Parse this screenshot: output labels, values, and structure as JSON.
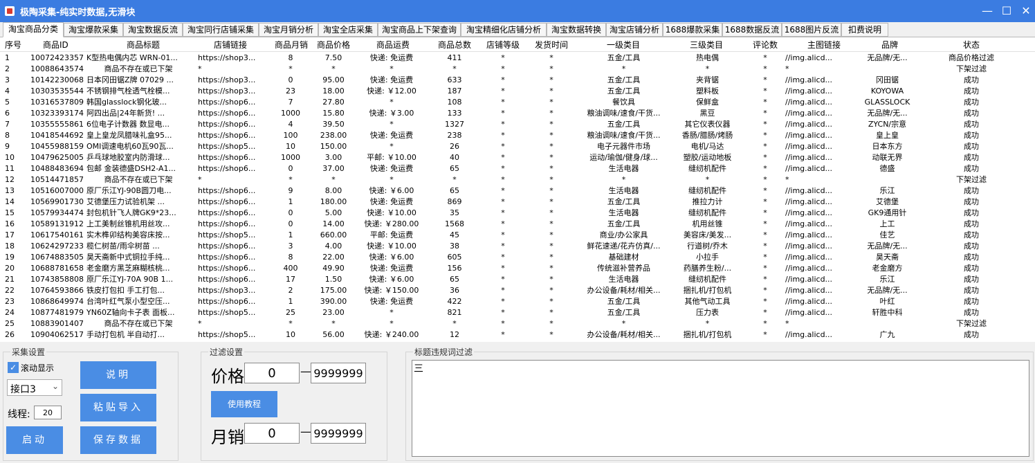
{
  "title": "极陶采集-纯实时数据,无滑块",
  "tabs": [
    "淘宝商品分类",
    "淘宝爆款采集",
    "淘宝数据反流",
    "淘宝同行店铺采集",
    "淘宝月销分析",
    "淘宝全店采集",
    "淘宝商品上下架查询",
    "淘宝精细化店铺分析",
    "淘宝数据转换",
    "淘宝店铺分析",
    "1688爆款采集",
    "1688数据反流",
    "1688图片反流",
    "扣费说明"
  ],
  "columns": [
    "序号",
    "商品ID",
    "商品标题",
    "店铺链接",
    "商品月销",
    "商品价格",
    "商品运费",
    "商品总数",
    "店铺等级",
    "发货时间",
    "一级类目",
    "三级类目",
    "评论数",
    "主图链接",
    "品牌",
    "状态"
  ],
  "rows": [
    [
      "1",
      "10072423357",
      "K型热电偶内芯 WRN-01...",
      "https://shop3...",
      "8",
      "7.50",
      "快递: 免运费",
      "411",
      "*",
      "*",
      "五金/工具",
      "热电偶",
      "*",
      "//img.alicd...",
      "无品牌/无...",
      "商品价格过滤"
    ],
    [
      "2",
      "10088643574",
      "商品不存在或已下架",
      "*",
      "*",
      "*",
      "*",
      "*",
      "*",
      "*",
      "*",
      "*",
      "*",
      "*",
      "",
      "下架过滤"
    ],
    [
      "3",
      "10142230068",
      "日本冈田锯Z牌 07029 ...",
      "https://shop3...",
      "0",
      "95.00",
      "快递: 免运费",
      "633",
      "*",
      "*",
      "五金/工具",
      "夹背锯",
      "*",
      "//img.alicd...",
      "冈田锯",
      "成功"
    ],
    [
      "4",
      "10303535544",
      "不锈钢排气栓透气栓模...",
      "https://shop3...",
      "23",
      "18.00",
      "快递: ￥12.00",
      "187",
      "*",
      "*",
      "五金/工具",
      "塑料板",
      "*",
      "//img.alicd...",
      "KOYOWA",
      "成功"
    ],
    [
      "5",
      "10316537809",
      "韩国glasslock钢化玻...",
      "https://shop6...",
      "7",
      "27.80",
      "*",
      "108",
      "*",
      "*",
      "餐饮具",
      "保鲜盒",
      "*",
      "//img.alicd...",
      "GLASSLOCK",
      "成功"
    ],
    [
      "6",
      "10323393174",
      "阿四出品|24年新货! ...",
      "https://shop6...",
      "1000",
      "15.80",
      "快递: ￥3.00",
      "133",
      "*",
      "*",
      "粮油调味/速食/干货...",
      "黑豆",
      "*",
      "//img.alicd...",
      "无品牌/无...",
      "成功"
    ],
    [
      "7",
      "10355555861",
      "6位电子计数器 数显电...",
      "https://shop6...",
      "4",
      "39.50",
      "*",
      "1327",
      "*",
      "*",
      "五金/工具",
      "其它仪表仪器",
      "*",
      "//img.alicd...",
      "ZYCN/宗意",
      "成功"
    ],
    [
      "8",
      "10418544692",
      "皇上皇龙凤腊味礼盒95...",
      "https://shop6...",
      "100",
      "238.00",
      "快递: 免运费",
      "238",
      "*",
      "*",
      "粮油调味/速食/干货...",
      "香肠/腊肠/烤肠",
      "*",
      "//img.alicd...",
      "皇上皇",
      "成功"
    ],
    [
      "9",
      "10455988159",
      "OMI调速电机60瓦90瓦...",
      "https://shop5...",
      "10",
      "150.00",
      "*",
      "26",
      "*",
      "*",
      "电子元器件市场",
      "电机/马达",
      "*",
      "//img.alicd...",
      "日本东方",
      "成功"
    ],
    [
      "10",
      "10479625005",
      "乒乓球地胶室内防滑球...",
      "https://shop6...",
      "1000",
      "3.00",
      "平邮: ￥10.00",
      "40",
      "*",
      "*",
      "运动/瑜伽/健身/球...",
      "塑胶/运动地板",
      "*",
      "//img.alicd...",
      "动联无界",
      "成功"
    ],
    [
      "11",
      "10488483694",
      "包邮 金装德盛DSH2-A1...",
      "https://shop6...",
      "0",
      "37.00",
      "快递: 免运费",
      "65",
      "*",
      "*",
      "生活电器",
      "缝纫机配件",
      "*",
      "//img.alicd...",
      "德盛",
      "成功"
    ],
    [
      "12",
      "10514471857",
      "商品不存在或已下架",
      "*",
      "*",
      "*",
      "*",
      "*",
      "*",
      "*",
      "*",
      "*",
      "*",
      "*",
      "",
      "下架过滤"
    ],
    [
      "13",
      "10516007000",
      "原厂乐江YJ-90B圆刀电...",
      "https://shop6...",
      "9",
      "8.00",
      "快递: ￥6.00",
      "65",
      "*",
      "*",
      "生活电器",
      "缝纫机配件",
      "*",
      "//img.alicd...",
      "乐江",
      "成功"
    ],
    [
      "14",
      "10569901730",
      "艾德堡压力试验机架 ...",
      "https://shop6...",
      "1",
      "180.00",
      "快递: 免运费",
      "869",
      "*",
      "*",
      "五金/工具",
      "推拉力计",
      "*",
      "//img.alicd...",
      "艾德堡",
      "成功"
    ],
    [
      "15",
      "10579934474",
      "封包机针飞人牌GK9*23...",
      "https://shop6...",
      "0",
      "5.00",
      "快递: ￥10.00",
      "35",
      "*",
      "*",
      "生活电器",
      "缝纫机配件",
      "*",
      "//img.alicd...",
      "GK9通用针",
      "成功"
    ],
    [
      "16",
      "10589131912",
      "上工美制丝锥机用丝攻...",
      "https://shop6...",
      "0",
      "14.00",
      "快递: ￥280.00",
      "1568",
      "*",
      "*",
      "五金/工具",
      "机用丝锥",
      "*",
      "//img.alicd...",
      "上工",
      "成功"
    ],
    [
      "17",
      "10617540161",
      "实木榫卯结构美容床按...",
      "https://shop5...",
      "1",
      "660.00",
      "平邮: 免运费",
      "45",
      "*",
      "*",
      "商业/办公家具",
      "美容床/美发...",
      "*",
      "//img.alicd...",
      "佳艺",
      "成功"
    ],
    [
      "18",
      "10624297233",
      "榄仁树苗/雨伞树苗 ...",
      "https://shop6...",
      "3",
      "4.00",
      "快递: ￥10.00",
      "38",
      "*",
      "*",
      "鲜花速递/花卉仿真/...",
      "行道树/乔木",
      "*",
      "//img.alicd...",
      "无品牌/无...",
      "成功"
    ],
    [
      "19",
      "10674883505",
      "昊天斋新中式铜拉手纯...",
      "https://shop6...",
      "8",
      "22.00",
      "快递: ￥6.00",
      "605",
      "*",
      "*",
      "基础建材",
      "小拉手",
      "*",
      "//img.alicd...",
      "昊天斋",
      "成功"
    ],
    [
      "20",
      "10688781658",
      "老金磨方黑芝麻糊核桃...",
      "https://shop6...",
      "400",
      "49.90",
      "快递: 免运费",
      "156",
      "*",
      "*",
      "传统滋补营养品",
      "药膳养生粉/...",
      "*",
      "//img.alicd...",
      "老金磨方",
      "成功"
    ],
    [
      "21",
      "10743858808",
      "原厂乐江YJ-70A 90B 1...",
      "https://shop6...",
      "17",
      "1.50",
      "快递: ￥6.00",
      "65",
      "*",
      "*",
      "生活电器",
      "缝纫机配件",
      "*",
      "//img.alicd...",
      "乐江",
      "成功"
    ],
    [
      "22",
      "10764593866",
      "铁皮打包扣 手工打包...",
      "https://shop3...",
      "2",
      "175.00",
      "快递: ￥150.00",
      "36",
      "*",
      "*",
      "办公设备/耗材/相关...",
      "捆扎机/打包机",
      "*",
      "//img.alicd...",
      "无品牌/无...",
      "成功"
    ],
    [
      "23",
      "10868649974",
      "台湾叶红气泵小型空压...",
      "https://shop6...",
      "1",
      "390.00",
      "快递: 免运费",
      "422",
      "*",
      "*",
      "五金/工具",
      "其他气动工具",
      "*",
      "//img.alicd...",
      "叶红",
      "成功"
    ],
    [
      "24",
      "10877481979",
      "YN60Z轴向卡子表 面板...",
      "https://shop5...",
      "25",
      "23.00",
      "*",
      "821",
      "*",
      "*",
      "五金/工具",
      "压力表",
      "*",
      "//img.alicd...",
      "轩胜中科",
      "成功"
    ],
    [
      "25",
      "10883901407",
      "商品不存在或已下架",
      "*",
      "*",
      "*",
      "*",
      "*",
      "*",
      "*",
      "*",
      "*",
      "*",
      "*",
      "",
      "下架过滤"
    ],
    [
      "26",
      "10904062517",
      "手动打包机 半自动打...",
      "https://shop5...",
      "10",
      "56.00",
      "快递: ￥240.00",
      "12",
      "*",
      "*",
      "办公设备/耗材/相关...",
      "捆扎机/打包机",
      "*",
      "//img.alicd...",
      "广九",
      "成功"
    ]
  ],
  "collect": {
    "group_label": "采集设置",
    "scroll_label": "滚动显示",
    "scroll_checked": true,
    "interface_value": "接口3",
    "threads_label": "线程:",
    "threads_value": "20",
    "btn_help": "说明",
    "btn_paste": "粘贴导入",
    "btn_start": "启动",
    "btn_save": "保存数据"
  },
  "filter": {
    "group_label": "过滤设置",
    "price_label": "价格",
    "price_min": "0",
    "price_max": "9999999",
    "dash": "—",
    "btn_tutorial": "使用教程",
    "sales_label": "月销",
    "sales_min": "0",
    "sales_max": "9999999"
  },
  "title_filter": {
    "group_label": "标题违规词过滤",
    "content": "三"
  }
}
